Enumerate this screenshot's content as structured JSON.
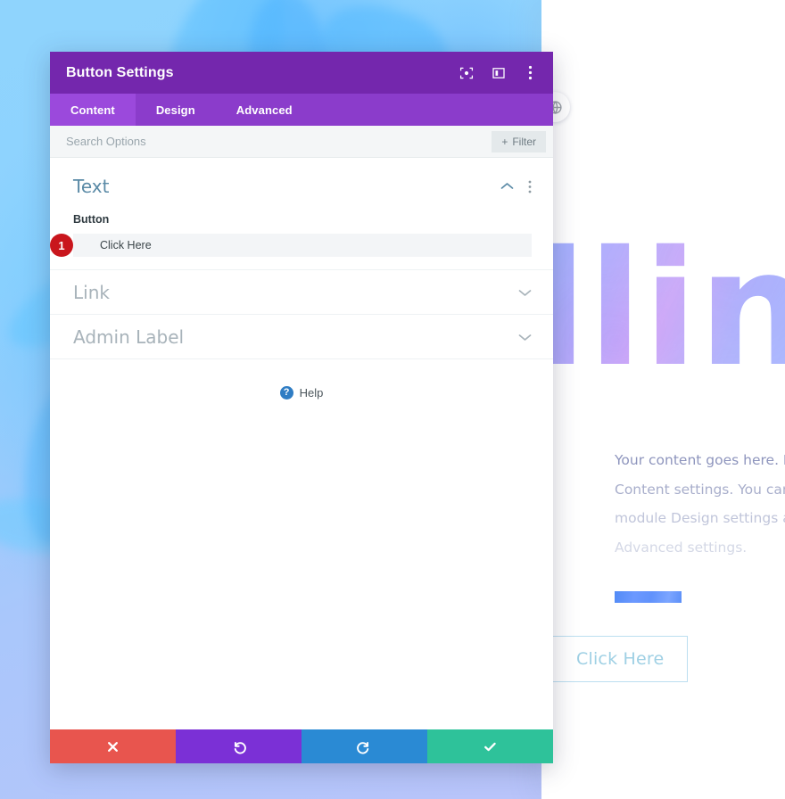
{
  "page": {
    "hero_heading": "llin",
    "body_lines": [
      "Your  content  goes  here.  Ed",
      "Content  settings.  You  can  ",
      "module Design settings and ",
      "Advanced settings."
    ],
    "cta_label": "Click Here",
    "globe_icon": "globe-icon"
  },
  "modal": {
    "title": "Button Settings",
    "header_icons": [
      {
        "name": "focus-target-icon"
      },
      {
        "name": "layout-panel-icon"
      },
      {
        "name": "more-vertical-icon"
      }
    ],
    "tabs": [
      {
        "label": "Content",
        "active": true
      },
      {
        "label": "Design",
        "active": false
      },
      {
        "label": "Advanced",
        "active": false
      }
    ],
    "search": {
      "placeholder": "Search Options",
      "value": "",
      "filter_label": "Filter",
      "filter_plus": "+"
    },
    "sections": [
      {
        "title": "Text",
        "expanded": true,
        "collapse_icon": "chevron-up-icon",
        "menu_icon": "more-vertical-icon",
        "field_label": "Button",
        "field_value": "Click Here",
        "badge": "1"
      },
      {
        "title": "Link",
        "expanded": false,
        "collapse_icon": "chevron-down-icon"
      },
      {
        "title": "Admin Label",
        "expanded": false,
        "collapse_icon": "chevron-down-icon"
      }
    ],
    "help": {
      "icon": "question-circle-icon",
      "label": "Help"
    },
    "footer_buttons": [
      {
        "name": "cancel-button",
        "icon": "close-x-icon",
        "color": "#e8554e"
      },
      {
        "name": "undo-button",
        "icon": "undo-icon",
        "color": "#7b30d6"
      },
      {
        "name": "redo-button",
        "icon": "redo-icon",
        "color": "#2a8ad4"
      },
      {
        "name": "save-button",
        "icon": "checkmark-icon",
        "color": "#2ec29a"
      }
    ]
  },
  "colors": {
    "header_purple": "#7427ad",
    "tabbar_purple": "#8b3ccb",
    "tab_active_purple": "#9b49dc",
    "section_title_blue": "#5a8aa6",
    "badge_red": "#c9161d",
    "help_blue": "#2f7dc4"
  }
}
